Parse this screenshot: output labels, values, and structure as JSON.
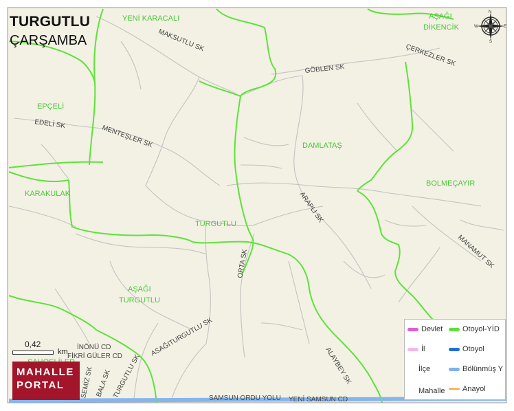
{
  "header": {
    "title": "TURGUTLU",
    "subtitle": "ÇARŞAMBA"
  },
  "colors": {
    "map_background": "#f2f1e3",
    "boundary": "#5ee23a",
    "road": "#c2c2c2",
    "highway": "#86b5ee",
    "neighborhood_label": "#4cc63a",
    "street_label": "#444444",
    "logo_background": "#a3152a"
  },
  "neighborhoods": [
    "YENİ KARACALI",
    "AŞAĞI",
    "DİKENCİK",
    "EPÇELİ",
    "DAMLATAŞ",
    "BOLMEÇAYIR",
    "KARAKULAK",
    "TURGUTLU",
    "AŞAĞI",
    "TURGUTLU",
    "SAHOELİLER"
  ],
  "streets": [
    "MAKSUTLU SK",
    "GÖBLEN SK",
    "ÇERKEZLER SK",
    "EDELİ SK",
    "MENTEŞLER SK",
    "ARAPLI SK",
    "MANAMUT SK",
    "ORTA SK",
    "ASAĞITURGUTLU SK",
    "İNÖNÜ CD",
    "FİKRİ GÜLER CD",
    "TURGUTLU SK",
    "ALAYBEY SK",
    "BALA SK",
    "SEMİZ SK",
    "SAMSUN ORDU YOLU",
    "YENİ SAMSUN CD"
  ],
  "compass": {
    "n": "N",
    "e": "E",
    "s": "S",
    "w": "W",
    "icon": "compass-rose-icon"
  },
  "scale": {
    "value": "0,42",
    "unit": "km"
  },
  "logo": {
    "line1": "MAHALLE",
    "line2": "PORTAL"
  },
  "legend": {
    "items": [
      {
        "label": "Devlet",
        "color": "#e55ad3"
      },
      {
        "label": "Otoyol-YİD",
        "color": "#5ee23a"
      },
      {
        "label": "İl",
        "color": "#f4b8e8"
      },
      {
        "label": "Otoyol",
        "color": "#1f6fd8"
      },
      {
        "label": "İlçe",
        "color": ""
      },
      {
        "label": "Bölünmüş Y",
        "color": "#7fb2ee"
      },
      {
        "label": "Mahalle",
        "color": ""
      },
      {
        "label": "Anayol",
        "color": "#f2a630"
      }
    ]
  }
}
